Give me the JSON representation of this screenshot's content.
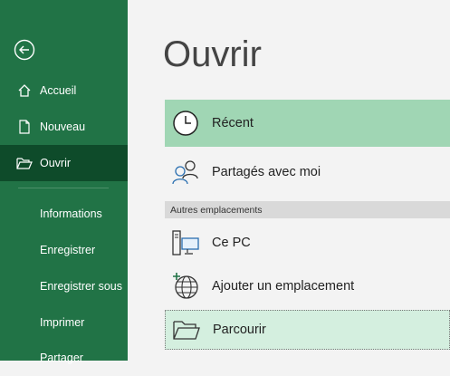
{
  "sidebar": {
    "items": [
      {
        "label": "Accueil"
      },
      {
        "label": "Nouveau"
      },
      {
        "label": "Ouvrir"
      },
      {
        "label": "Informations"
      },
      {
        "label": "Enregistrer"
      },
      {
        "label": "Enregistrer sous"
      },
      {
        "label": "Imprimer"
      },
      {
        "label": "Partager"
      }
    ]
  },
  "main": {
    "title": "Ouvrir",
    "recent_label": "Récent",
    "shared_label": "Partagés avec moi",
    "section_header": "Autres emplacements",
    "pc_label": "Ce PC",
    "add_location_label": "Ajouter un emplacement",
    "browse_label": "Parcourir"
  },
  "colors": {
    "sidebar_bg": "#217346",
    "sidebar_active": "#0e4b2a",
    "recent_highlight": "#a0d6b4",
    "browse_highlight": "#d4efdf"
  }
}
